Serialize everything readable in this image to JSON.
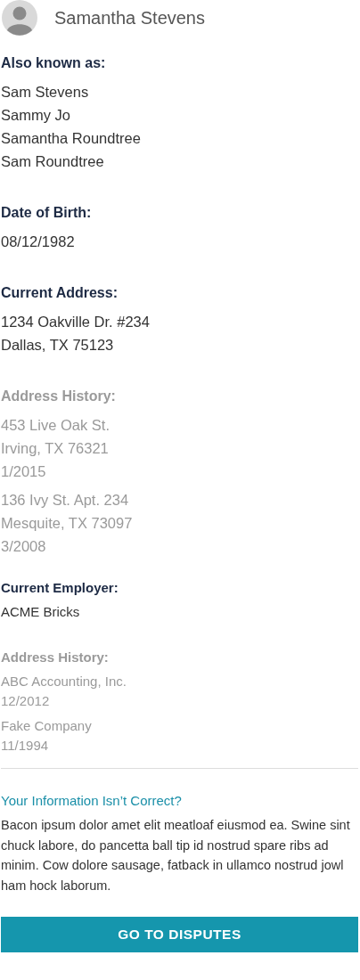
{
  "profile": {
    "name": "Samantha Stevens"
  },
  "identity_sections": [
    {
      "heading": "Also known as:",
      "muted": false,
      "entries": [
        [
          "Sam Stevens",
          "Sammy Jo",
          "Samantha Roundtree",
          "Sam Roundtree"
        ]
      ]
    },
    {
      "heading": "Date of Birth:",
      "muted": false,
      "entries": [
        [
          "08/12/1982"
        ]
      ]
    },
    {
      "heading": "Current Address:",
      "muted": false,
      "entries": [
        [
          "1234 Oakville Dr. #234",
          "Dallas, TX 75123"
        ]
      ]
    },
    {
      "heading": "Address History:",
      "muted": true,
      "entries": [
        [
          "453 Live Oak St.",
          "Irving, TX 76321",
          "1/2015"
        ],
        [
          "136 Ivy St. Apt. 234",
          "Mesquite, TX 73097",
          "3/2008"
        ]
      ]
    }
  ],
  "employment_sections": [
    {
      "heading": "Current Employer:",
      "muted": false,
      "entries": [
        [
          "ACME Bricks"
        ]
      ]
    },
    {
      "heading": "Address History:",
      "muted": true,
      "entries": [
        [
          "ABC Accounting, Inc.",
          "12/2012"
        ],
        [
          "Fake Company",
          "11/1994"
        ]
      ]
    }
  ],
  "help": {
    "heading": "Your Information Isn’t Correct?",
    "text": "Bacon ipsum dolor amet elit meatloaf eiusmod ea. Swine sint chuck labore, do pancetta ball tip id nostrud spare ribs ad minim. Cow dolore sausage, fatback in ullamco nostrud jowl ham hock laborum."
  },
  "button": {
    "label": "GO TO DISPUTES"
  }
}
